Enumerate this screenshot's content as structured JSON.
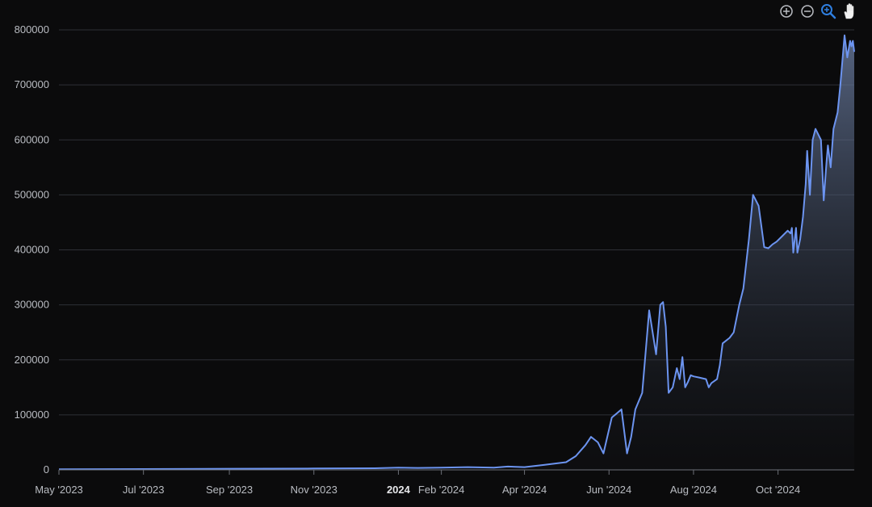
{
  "toolbar": {
    "icons": [
      "zoom-in-icon",
      "zoom-out-icon",
      "zoom-select-icon",
      "pan-hand-icon"
    ],
    "active_color": "#2f7fe0",
    "icon_color": "#b9bcc2"
  },
  "chart_data": {
    "type": "area",
    "title": "",
    "xlabel": "",
    "ylabel": "",
    "line_color": "#6c94f0",
    "grid": true,
    "xlim": [
      "2023-05-01",
      "2024-11-25"
    ],
    "ylim": [
      0,
      800000
    ],
    "yticks": [
      {
        "value": 0,
        "label": "0"
      },
      {
        "value": 100000,
        "label": "100000"
      },
      {
        "value": 200000,
        "label": "200000"
      },
      {
        "value": 300000,
        "label": "300000"
      },
      {
        "value": 400000,
        "label": "400000"
      },
      {
        "value": 500000,
        "label": "500000"
      },
      {
        "value": 600000,
        "label": "600000"
      },
      {
        "value": 700000,
        "label": "700000"
      },
      {
        "value": 800000,
        "label": "800000"
      }
    ],
    "xticks": [
      {
        "date": "2023-05-01",
        "label": "May '2023",
        "bold": false
      },
      {
        "date": "2023-07-01",
        "label": "Jul '2023",
        "bold": false
      },
      {
        "date": "2023-09-01",
        "label": "Sep '2023",
        "bold": false
      },
      {
        "date": "2023-11-01",
        "label": "Nov '2023",
        "bold": false
      },
      {
        "date": "2024-01-01",
        "label": "2024",
        "bold": true
      },
      {
        "date": "2024-02-01",
        "label": "Feb '2024",
        "bold": false
      },
      {
        "date": "2024-04-01",
        "label": "Apr '2024",
        "bold": false
      },
      {
        "date": "2024-06-01",
        "label": "Jun '2024",
        "bold": false
      },
      {
        "date": "2024-08-01",
        "label": "Aug '2024",
        "bold": false
      },
      {
        "date": "2024-10-01",
        "label": "Oct '2024",
        "bold": false
      }
    ],
    "series": [
      {
        "x": [
          "2023-05-01",
          "2023-07-01",
          "2023-09-01",
          "2023-11-01",
          "2023-12-15",
          "2024-01-01",
          "2024-01-15",
          "2024-02-01",
          "2024-02-20",
          "2024-03-10",
          "2024-03-20",
          "2024-04-01",
          "2024-04-15",
          "2024-05-01",
          "2024-05-08",
          "2024-05-15",
          "2024-05-19",
          "2024-05-24",
          "2024-05-28",
          "2024-06-03",
          "2024-06-10",
          "2024-06-14",
          "2024-06-17",
          "2024-06-20",
          "2024-06-25",
          "2024-06-30",
          "2024-07-05",
          "2024-07-08",
          "2024-07-10",
          "2024-07-12",
          "2024-07-14",
          "2024-07-17",
          "2024-07-20",
          "2024-07-22",
          "2024-07-24",
          "2024-07-26",
          "2024-07-28",
          "2024-07-30",
          "2024-08-01",
          "2024-08-05",
          "2024-08-10",
          "2024-08-12",
          "2024-08-14",
          "2024-08-18",
          "2024-08-20",
          "2024-08-22",
          "2024-08-27",
          "2024-08-30",
          "2024-09-03",
          "2024-09-06",
          "2024-09-10",
          "2024-09-13",
          "2024-09-17",
          "2024-09-21",
          "2024-09-24",
          "2024-09-27",
          "2024-09-30",
          "2024-10-04",
          "2024-10-08",
          "2024-10-10",
          "2024-10-11",
          "2024-10-12",
          "2024-10-14",
          "2024-10-15",
          "2024-10-17",
          "2024-10-19",
          "2024-10-21",
          "2024-10-22",
          "2024-10-24",
          "2024-10-26",
          "2024-10-28",
          "2024-10-30",
          "2024-11-01",
          "2024-11-03",
          "2024-11-05",
          "2024-11-06",
          "2024-11-08",
          "2024-11-10",
          "2024-11-13",
          "2024-11-15",
          "2024-11-18",
          "2024-11-20",
          "2024-11-22",
          "2024-11-23",
          "2024-11-24",
          "2024-11-25"
        ],
        "y": [
          1000,
          1500,
          2000,
          2500,
          3000,
          4000,
          3500,
          4000,
          5000,
          4000,
          6000,
          5000,
          9000,
          14000,
          25000,
          45000,
          60000,
          50000,
          30000,
          95000,
          110000,
          30000,
          60000,
          110000,
          140000,
          290000,
          210000,
          300000,
          305000,
          260000,
          140000,
          150000,
          185000,
          165000,
          205000,
          150000,
          160000,
          172000,
          170000,
          168000,
          165000,
          150000,
          158000,
          165000,
          190000,
          230000,
          240000,
          250000,
          300000,
          330000,
          420000,
          500000,
          480000,
          405000,
          403000,
          410000,
          415000,
          425000,
          435000,
          430000,
          440000,
          395000,
          440000,
          395000,
          420000,
          460000,
          520000,
          580000,
          500000,
          600000,
          620000,
          610000,
          600000,
          490000,
          560000,
          590000,
          550000,
          620000,
          650000,
          700000,
          790000,
          750000,
          780000,
          770000,
          780000,
          760000
        ]
      }
    ]
  }
}
